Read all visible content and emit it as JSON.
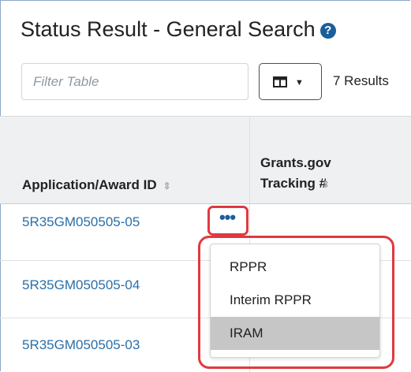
{
  "header": {
    "title": "Status Result - General Search",
    "help_icon": "?"
  },
  "toolbar": {
    "filter_placeholder": "Filter Table",
    "results_text": "7 Results",
    "column_button_icon": "table-columns-icon"
  },
  "table": {
    "columns": [
      "Application/Award ID",
      "Grants.gov Tracking #"
    ],
    "sort_icon": "⇕",
    "rows": [
      {
        "award_id": "5R35GM050505-05"
      },
      {
        "award_id": "5R35GM050505-04"
      },
      {
        "award_id": "5R35GM050505-03"
      }
    ]
  },
  "action_menu": {
    "trigger_icon": "•••",
    "items": [
      "RPPR",
      "Interim RPPR",
      "IRAM"
    ],
    "highlighted_item": "IRAM"
  },
  "colors": {
    "link": "#2a6fa8",
    "highlight_border": "#e0393f",
    "brand": "#1a5e9a"
  }
}
